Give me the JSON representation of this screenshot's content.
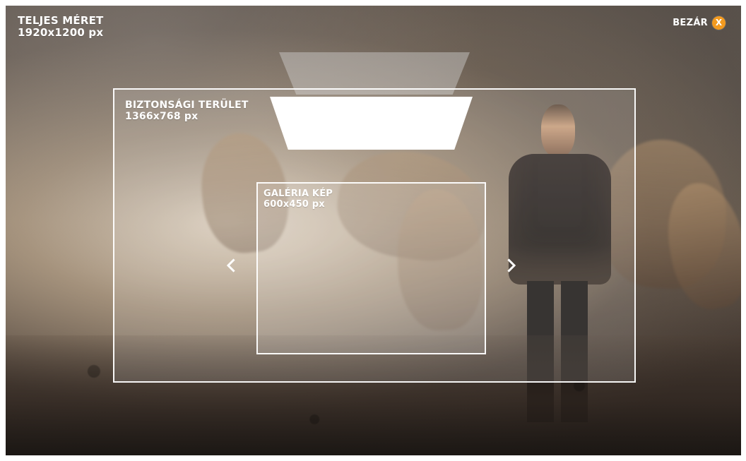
{
  "overlay": {
    "full_size": {
      "title": "TELJES MÉRET",
      "size": "1920x1200 px"
    },
    "safe_area": {
      "title": "BIZTONSÁGI TERÜLET",
      "size": "1366x768 px"
    },
    "gallery_image": {
      "title": "GALÉRIA KÉP",
      "size": "600x450 px"
    },
    "close": {
      "label": "BEZÁR",
      "icon_text": "X",
      "icon_name": "close-icon",
      "accent": "#f39a1f"
    },
    "navigation": {
      "previous_icon": "chevron-left-icon",
      "next_icon": "chevron-right-icon"
    }
  }
}
